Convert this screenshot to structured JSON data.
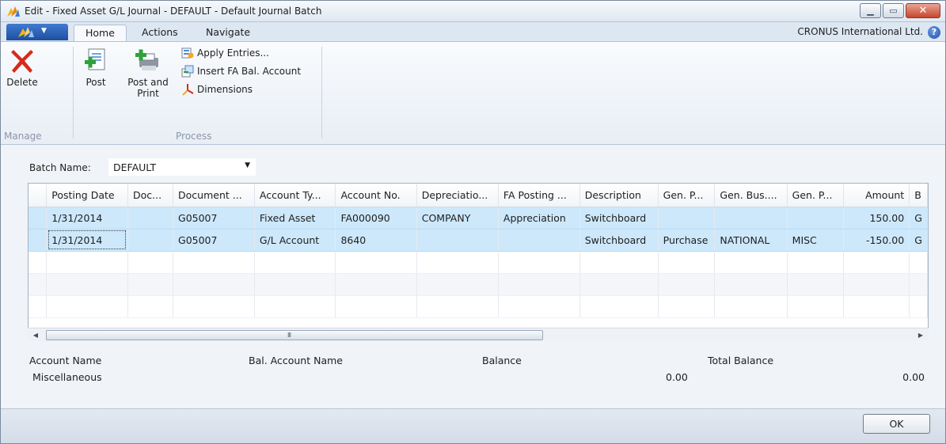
{
  "window": {
    "title": "Edit - Fixed Asset G/L Journal - DEFAULT - Default Journal Batch",
    "company": "CRONUS International Ltd."
  },
  "ribbon": {
    "tabs": [
      "Home",
      "Actions",
      "Navigate"
    ],
    "active_tab": "Home",
    "manage": {
      "group_label": "Manage",
      "delete_label": "Delete"
    },
    "process": {
      "group_label": "Process",
      "post_label": "Post",
      "post_print_line1": "Post and",
      "post_print_line2": "Print",
      "apply_entries_label": "Apply Entries...",
      "insert_fa_label": "Insert FA Bal. Account",
      "dimensions_label": "Dimensions"
    }
  },
  "batch": {
    "label": "Batch Name:",
    "value": "DEFAULT"
  },
  "grid": {
    "columns": [
      "Posting Date",
      "Doc...",
      "Document ...",
      "Account Ty...",
      "Account No.",
      "Depreciatio...",
      "FA Posting ...",
      "Description",
      "Gen. P...",
      "Gen. Bus....",
      "Gen. P...",
      "Amount",
      "B"
    ],
    "rows": [
      [
        "1/31/2014",
        "",
        "G05007",
        "Fixed Asset",
        "FA000090",
        "COMPANY",
        "Appreciation",
        "Switchboard",
        "",
        "",
        "",
        "150.00",
        "G"
      ],
      [
        "1/31/2014",
        "",
        "G05007",
        "G/L Account",
        "8640",
        "",
        "",
        "Switchboard",
        "Purchase",
        "NATIONAL",
        "MISC",
        "-150.00",
        "G"
      ]
    ],
    "scroll_grip": "III"
  },
  "footer": {
    "account_name_label": "Account Name",
    "account_name_value": "Miscellaneous",
    "bal_account_name_label": "Bal. Account Name",
    "balance_label": "Balance",
    "balance_value": "0.00",
    "total_balance_label": "Total Balance",
    "total_balance_value": "0.00"
  },
  "buttons": {
    "ok_label": "OK"
  },
  "colors": {
    "selected_row": "#cde8fb",
    "ribbon_app_button": "#2a5fb8",
    "delete_red": "#d62a1c",
    "post_green": "#2fa13a"
  },
  "icons": [
    "app-icon",
    "minimize-icon",
    "maximize-icon",
    "close-icon",
    "help-icon",
    "delete-icon",
    "post-icon",
    "post-and-print-icon",
    "apply-entries-icon",
    "insert-fa-icon",
    "dimensions-icon"
  ]
}
